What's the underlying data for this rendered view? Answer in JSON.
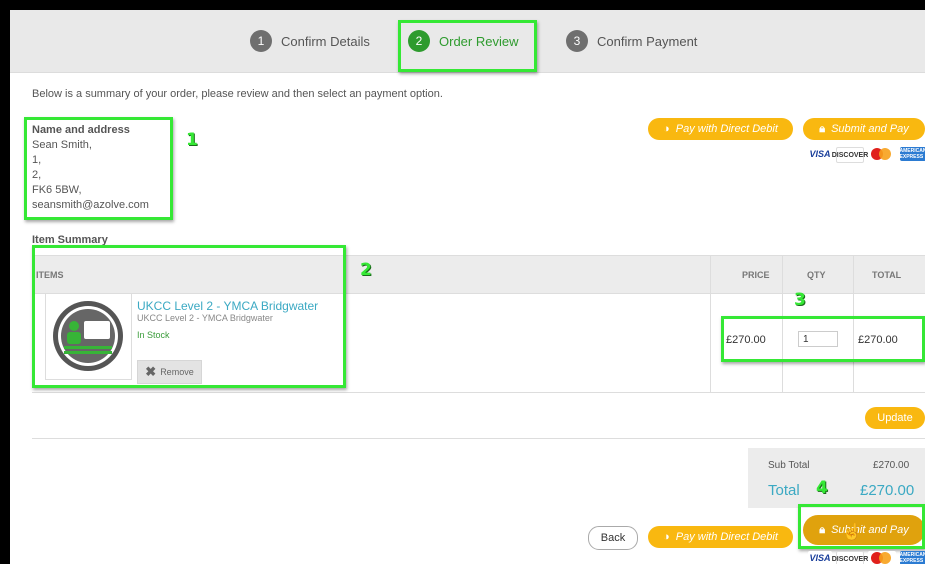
{
  "steps": [
    {
      "num": "1",
      "label": "Confirm Details"
    },
    {
      "num": "2",
      "label": "Order Review"
    },
    {
      "num": "3",
      "label": "Confirm Payment"
    }
  ],
  "intro": "Below is a summary of your order, please review and then select an payment option.",
  "address": {
    "heading": "Name and address",
    "lines": [
      "Sean Smith,",
      "1,",
      "2,",
      "FK6 5BW,",
      "seansmith@azolve.com"
    ]
  },
  "buttons": {
    "direct_debit": "Pay with Direct Debit",
    "submit_pay": "Submit and Pay",
    "update": "Update",
    "back": "Back",
    "remove": "Remove"
  },
  "cards": {
    "visa": "VISA",
    "discover": "DISCOVER",
    "mastercard": "",
    "amex": "AMERICAN EXPRESS"
  },
  "item_summary": "Item Summary",
  "table": {
    "headers": {
      "items": "ITEMS",
      "price": "PRICE",
      "qty": "QTY",
      "total": "TOTAL"
    },
    "rows": [
      {
        "title": "UKCC Level 2 - YMCA Bridgwater",
        "subtitle": "UKCC Level 2 - YMCA Bridgwater",
        "stock": "In Stock",
        "price": "£270.00",
        "qty": "1",
        "total": "£270.00"
      }
    ]
  },
  "totals": {
    "sub_label": "Sub Total",
    "sub_value": "£270.00",
    "total_label": "Total",
    "total_value": "£270.00"
  },
  "callouts": [
    "1",
    "2",
    "3",
    "4"
  ],
  "colors": {
    "accent_green": "#2e9b2e",
    "highlight": "#35e835",
    "button_yellow": "#f9b810",
    "link_teal": "#3ba9c3"
  }
}
